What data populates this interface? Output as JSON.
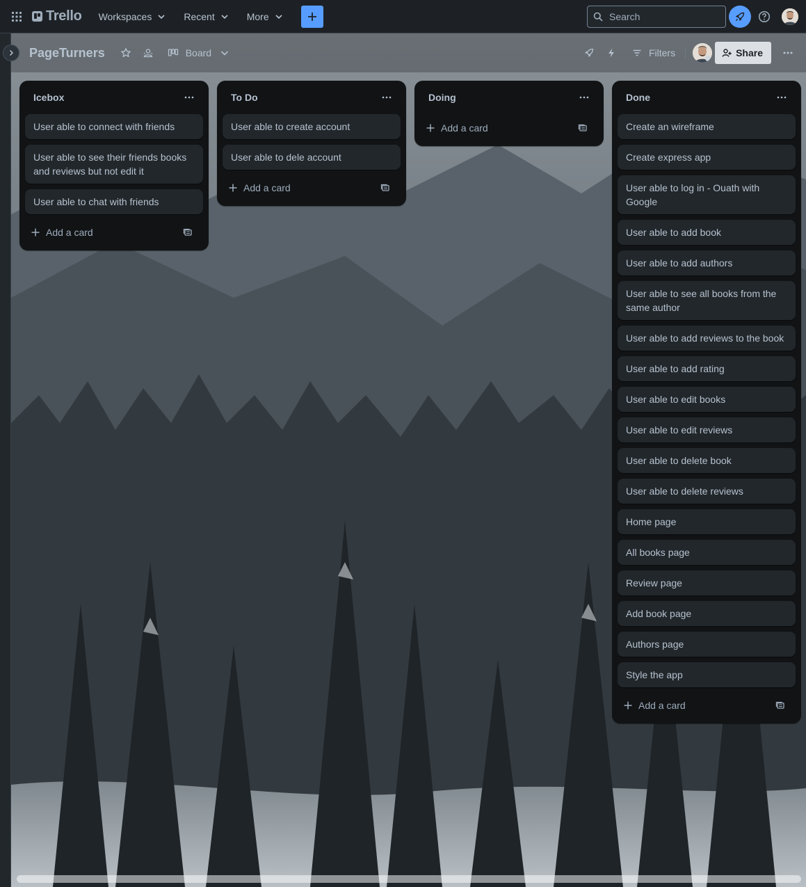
{
  "app": {
    "logo": "Trello",
    "nav": {
      "workspaces": "Workspaces",
      "recent": "Recent",
      "more": "More"
    },
    "search_placeholder": "Search",
    "accent_color": "#579dff"
  },
  "board": {
    "title": "PageTurners",
    "view": "Board",
    "filters": "Filters",
    "share": "Share"
  },
  "lists": [
    {
      "title": "Icebox",
      "cards": [
        "User able to connect with friends",
        "User able to see their friends books and reviews but not edit it",
        "User able to chat with friends"
      ],
      "add_label": "Add a card"
    },
    {
      "title": "To Do",
      "cards": [
        "User able to create account",
        "User able to dele account"
      ],
      "add_label": "Add a card"
    },
    {
      "title": "Doing",
      "cards": [],
      "add_label": "Add a card"
    },
    {
      "title": "Done",
      "cards": [
        "Create an wireframe",
        "Create express app",
        "User able to log in - Ouath with Google",
        "User able to add book",
        "User able to add authors",
        "User able to see all books from the same author",
        "User able to add reviews to the book",
        "User able to add rating",
        "User able to edit books",
        "User able to edit reviews",
        "User able to delete book",
        "User able to delete reviews",
        "Home page",
        "All books page",
        "Review page",
        "Add book page",
        "Authors page",
        "Style the app"
      ],
      "add_label": "Add a card"
    }
  ]
}
